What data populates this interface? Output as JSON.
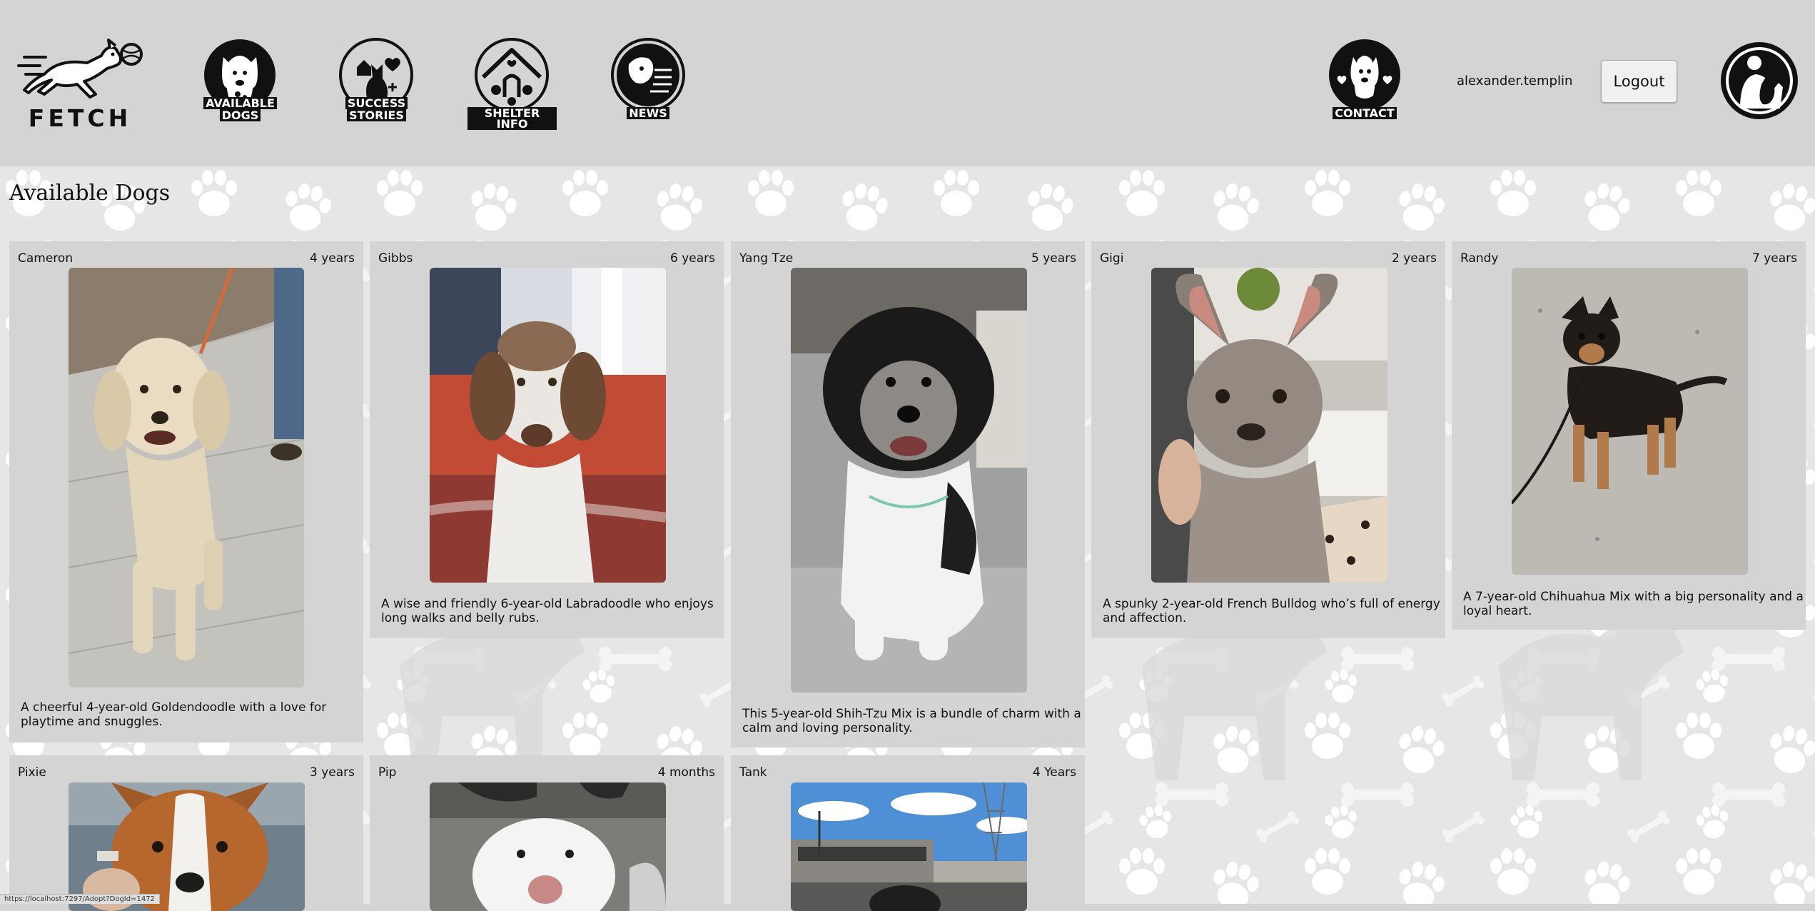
{
  "header": {
    "logo_text": "FETCH",
    "nav": [
      {
        "line1": "AVAILABLE",
        "line2": "DOGS"
      },
      {
        "line1": "SUCCESS",
        "line2": "STORIES"
      },
      {
        "line1": "SHELTER INFO",
        "line2": ""
      },
      {
        "line1": "NEWS",
        "line2": ""
      }
    ],
    "contact_label": "CONTACT",
    "username": "alexander.templin",
    "logout_label": "Logout"
  },
  "page": {
    "title": "Available Dogs"
  },
  "dogs": [
    {
      "name": "Cameron",
      "age": "4 years",
      "description_line1": "A cheerful 4-year-old Goldendoodle with a love for",
      "description_line2": "playtime and snuggles."
    },
    {
      "name": "Gibbs",
      "age": "6 years",
      "description_line1": "A wise and friendly 6-year-old Labradoodle who enjoys",
      "description_line2": "long walks and belly rubs."
    },
    {
      "name": "Yang Tze",
      "age": "5 years",
      "description_line1": "This 5-year-old Shih-Tzu Mix is a bundle of charm with a",
      "description_line2": "calm and loving personality."
    },
    {
      "name": "Gigi",
      "age": "2 years",
      "description_line1": "A spunky 2-year-old French Bulldog who’s full of energy",
      "description_line2": "and affection."
    },
    {
      "name": "Randy",
      "age": "7 years",
      "description_line1": "A 7-year-old Chihuahua Mix with a big personality and a",
      "description_line2": "loyal heart."
    },
    {
      "name": "Pixie",
      "age": "3 years",
      "description_line1": "",
      "description_line2": ""
    },
    {
      "name": "Pip",
      "age": "4 months",
      "description_line1": "",
      "description_line2": ""
    },
    {
      "name": "Tank",
      "age": "4 Years",
      "description_line1": "",
      "description_line2": ""
    }
  ],
  "status_bar": {
    "url": "https://localhost:7297/Adopt?DogId=1472"
  },
  "colors": {
    "header_bg": "#d4d4d4",
    "card_bg": "#d4d4d4",
    "pattern_bg": "#e6e6e6",
    "icon_dark": "#111111"
  }
}
